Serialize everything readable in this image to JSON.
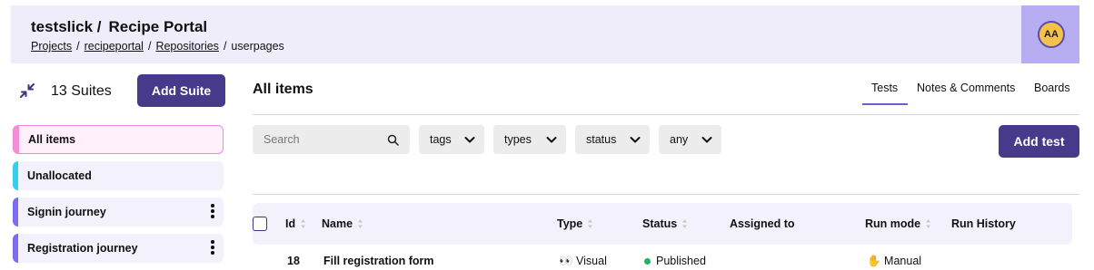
{
  "header": {
    "org": "testslick /",
    "project": "Recipe Portal",
    "breadcrumbs": [
      "Projects",
      "recipeportal",
      "Repositories"
    ],
    "current_page": "userpages",
    "avatar_initials": "AA"
  },
  "sidebar": {
    "suite_count": "13 Suites",
    "add_suite_label": "Add Suite",
    "suites": [
      {
        "label": "All items",
        "color": "#f48bd6"
      },
      {
        "label": "Unallocated",
        "color": "#35d0f0"
      },
      {
        "label": "Signin journey",
        "color": "#7b6cf0"
      },
      {
        "label": "Registration journey",
        "color": "#7b6cf0"
      }
    ]
  },
  "main": {
    "title": "All items",
    "tabs": [
      "Tests",
      "Notes & Comments",
      "Boards"
    ],
    "active_tab": "Tests",
    "search_placeholder": "Search",
    "filters": [
      "tags",
      "types",
      "status",
      "any"
    ],
    "add_test_label": "Add test"
  },
  "table": {
    "columns": [
      "Id",
      "Name",
      "Type",
      "Status",
      "Assigned to",
      "Run mode",
      "Run History"
    ],
    "rows": [
      {
        "id": "18",
        "name": "Fill registration form",
        "type": "Visual",
        "status": "Published",
        "run_mode": "Manual"
      }
    ]
  },
  "colors": {
    "accent": "#473a8a",
    "header_bg": "#efedfa",
    "avatar_bg": "#f3c24a",
    "published": "#1fb35b"
  }
}
